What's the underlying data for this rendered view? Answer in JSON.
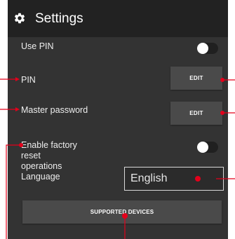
{
  "header": {
    "title": "Settings",
    "icon": "gear-icon"
  },
  "settings": {
    "use_pin": {
      "label": "Use PIN",
      "enabled": false
    },
    "pin": {
      "label": "PIN",
      "button_label": "EDIT"
    },
    "master_password": {
      "label": "Master password",
      "button_label": "EDIT"
    },
    "factory_reset": {
      "label_lines": [
        "Enable factory",
        "reset",
        "operations"
      ],
      "enabled": false
    },
    "language": {
      "label": "Language",
      "value": "English"
    },
    "supported_devices": {
      "button_label": "SUPPORTED DEVICES"
    }
  },
  "colors": {
    "annotation": "#e3001b",
    "header_bg": "#222222",
    "panel_bg": "#333333",
    "button_bg": "#4a4a4a"
  }
}
